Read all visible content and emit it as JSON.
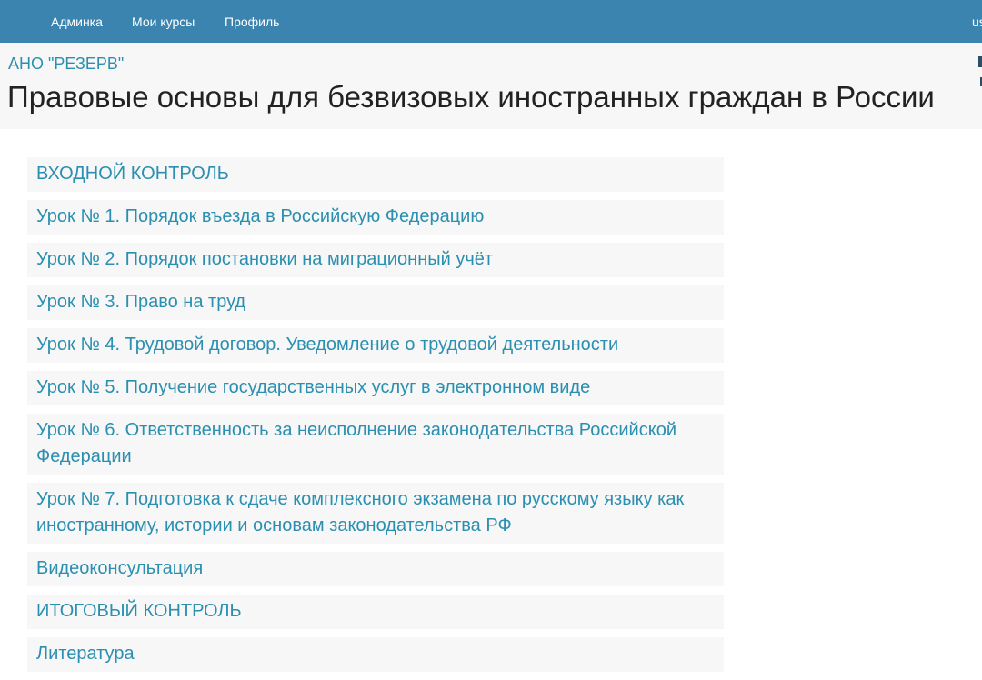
{
  "navbar": {
    "items": [
      {
        "label": "Админка"
      },
      {
        "label": "Мои курсы"
      },
      {
        "label": "Профиль"
      }
    ],
    "user_label": "us"
  },
  "header": {
    "organization": "АНО \"РЕЗЕРВ\"",
    "title": "Правовые основы для безвизовых иностранных граждан в России"
  },
  "lessons": [
    {
      "label": "ВХОДНОЙ КОНТРОЛЬ"
    },
    {
      "label": "Урок № 1. Порядок въезда в Российскую Федерацию"
    },
    {
      "label": "Урок № 2. Порядок постановки на миграционный учёт"
    },
    {
      "label": "Урок № 3. Право на труд"
    },
    {
      "label": "Урок № 4. Трудовой договор. Уведомление о трудовой деятельности"
    },
    {
      "label": "Урок № 5. Получение государственных услуг в электронном виде"
    },
    {
      "label": "Урок № 6. Ответственность за неисполнение законодательства Российской Федерации"
    },
    {
      "label": "Урок № 7. Подготовка к сдаче комплексного экзамена по русскому языку как иностранному, истории и основам законодательства РФ"
    },
    {
      "label": "Видеоконсультация"
    },
    {
      "label": "ИТОГОВЫЙ КОНТРОЛЬ"
    },
    {
      "label": "Литература"
    }
  ],
  "colors": {
    "navbar": "#3b84b0",
    "link": "#2a8fb0",
    "title": "#222222",
    "item_background": "#f7f7f7"
  }
}
